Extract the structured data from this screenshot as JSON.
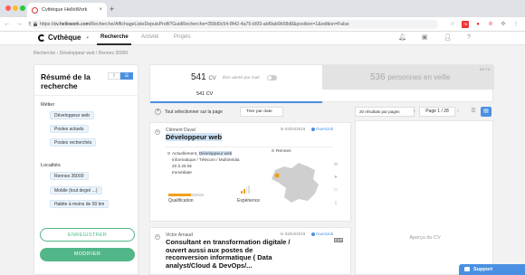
{
  "browser": {
    "tab_title": "Cvthèque HelloWork",
    "url_prefix": "https://",
    "url_host": "cv.hellowork.com",
    "url_path": "/Recherche/AffichageListeDepuisProfil?GuidRecherche=358d0c54-8f42-4a75-b5f3-abf9ab0b58d8&position=1&edition=False"
  },
  "app": {
    "logo": "Cvthèque",
    "nav": [
      "Recherche",
      "Activité",
      "Projets"
    ]
  },
  "breadcrumb": "Recherche  ›  Développeur web / Rennes 35000",
  "left_panel": {
    "title": "Résumé de la recherche",
    "metier_label": "Métier",
    "metier_chips": [
      "Développeur web",
      "Postes actuels",
      "Postes recherchés"
    ],
    "localites_label": "Localités",
    "localites_chips": [
      "Rennes 35000",
      "Mobile (tout degré ...)",
      "Habite à moins de 50 km"
    ],
    "save_label": "ENREGISTRER",
    "modify_label": "MODIFIER"
  },
  "results": {
    "cv_count": "541",
    "cv_unit": "CV",
    "alert_label": "Être alerté par mail",
    "pv_count": "536",
    "pv_label": "personnes en veille",
    "beta": "BETA",
    "subtab": "541 CV"
  },
  "toolbar": {
    "select_all": "Tout sélectionner sur la page",
    "sort": "Trier par date",
    "per_page": "20 résultats par pages",
    "pager": "Page 1 / 28"
  },
  "cards": [
    {
      "name": "Clément Duval",
      "title_pre": "",
      "title_hl": "Développeur web",
      "title_post": "",
      "date": "le 03/04/2019",
      "source": "OuestJob",
      "current_pre": "Actuellement, ",
      "current_hl": "Développeur web",
      "sector": "Informatique / Télécom / Multimédia",
      "salary": "20 à 25 k€",
      "availability": "Immédiate",
      "location": "Rennes",
      "qualification_label": "Qualification",
      "experience_label": "Expérience",
      "qualification_level": 0.65,
      "experience_level": 2
    },
    {
      "name": "Victor Arnaud",
      "title": "Consultant en transformation digitale / ouvert aussi aux postes de reconversion informatique ( Data analyst/Cloud & DevOps/...",
      "date": "le 03/04/2019",
      "source": "OuestJob",
      "tag": "EXP"
    }
  ],
  "preview": {
    "label": "Aperçu du CV"
  },
  "support": {
    "label": "Support"
  }
}
